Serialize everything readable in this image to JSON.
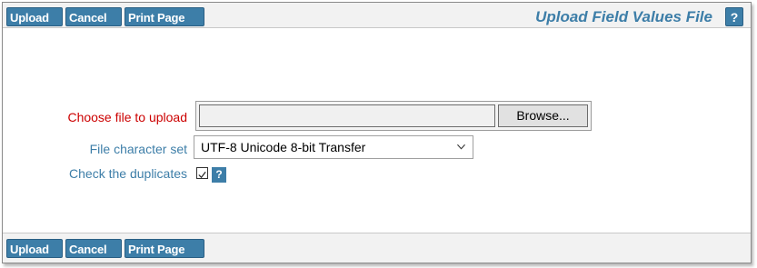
{
  "toolbar": {
    "upload_label": "Upload",
    "cancel_label": "Cancel",
    "print_label": "Print Page"
  },
  "header": {
    "title": "Upload Field Values File",
    "help_label": "?"
  },
  "form": {
    "file_label": "Choose file to upload",
    "browse_label": "Browse...",
    "file_value": "",
    "charset_label": "File character set",
    "charset_value": "UTF-8 Unicode 8-bit Transfer",
    "duplicates_label": "Check the duplicates",
    "duplicates_checked": true,
    "duplicates_help": "?"
  },
  "colors": {
    "accent": "#3d7ea8",
    "required": "#cc0000"
  },
  "icons": {
    "select_arrow": "chevron-down-icon",
    "checkbox_mark": "check-icon",
    "help": "help-icon"
  }
}
